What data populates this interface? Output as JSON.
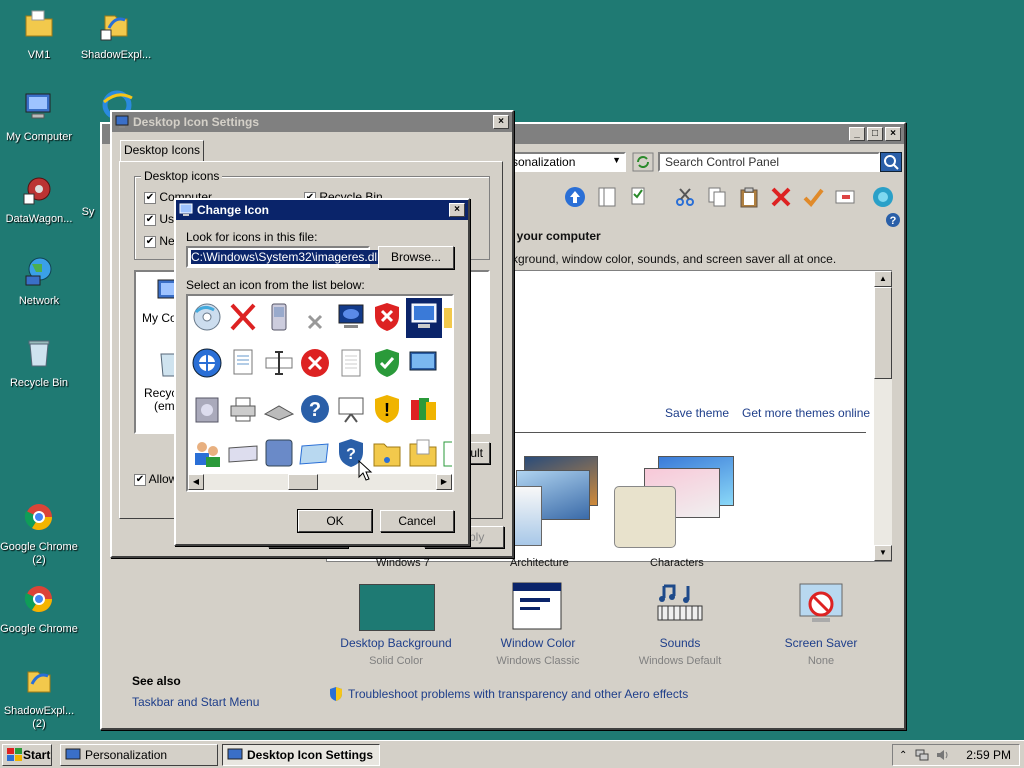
{
  "desktop": {
    "icons": [
      {
        "label": "VM1"
      },
      {
        "label": "ShadowExpl..."
      },
      {
        "label": "My Computer"
      },
      {
        "label": "DataWagon..."
      },
      {
        "label": "Sy"
      },
      {
        "label": "Network"
      },
      {
        "label": "Recycle Bin"
      },
      {
        "label": "Google Chrome\n(2)"
      },
      {
        "label": "Google Chrome"
      },
      {
        "label": "ShadowExpl...\n(2)"
      }
    ]
  },
  "control_panel": {
    "address_text": "sonalization",
    "search_placeholder": "Search Control Panel",
    "heading": "n your computer",
    "description": "ckground, window color, sounds, and screen saver all at once.",
    "save_theme": "Save theme",
    "get_more_themes": "Get more themes online",
    "themes": [
      {
        "label": "Windows 7"
      },
      {
        "label": "Architecture"
      },
      {
        "label": "Characters"
      }
    ],
    "bottom_items": [
      {
        "title": "Desktop Background",
        "subtitle": "Solid Color"
      },
      {
        "title": "Window Color",
        "subtitle": "Windows Classic"
      },
      {
        "title": "Sounds",
        "subtitle": "Windows Default"
      },
      {
        "title": "Screen Saver",
        "subtitle": "None"
      }
    ],
    "see_also_label": "See also",
    "taskbar_link": "Taskbar and Start Menu",
    "troubleshoot_link": "Troubleshoot problems with transparency and other Aero effects",
    "accent_color": "#1e7a73"
  },
  "desktop_icon_settings": {
    "title": "Desktop Icon Settings",
    "tab_label": "Desktop Icons",
    "group_label": "Desktop icons",
    "checkboxes": [
      {
        "label": "Computer",
        "checked": true
      },
      {
        "label": "Us",
        "checked": true
      },
      {
        "label": "Ne",
        "checked": true
      },
      {
        "label": "Recycle Bin",
        "checked": true
      }
    ],
    "preview_labels": [
      "My Co",
      "Recyc",
      "(emp"
    ],
    "allow_label": "Allow",
    "restore_default_fragment": "ault",
    "apply_fragment": "ply"
  },
  "change_icon": {
    "title": "Change Icon",
    "look_label": "Look for icons in this file:",
    "file_path": "C:\\Windows\\System32\\imageres.dll",
    "browse_label": "Browse...",
    "select_label": "Select an icon from the list below:",
    "ok_label": "OK",
    "cancel_label": "Cancel"
  },
  "taskbar": {
    "start_label": "Start",
    "tasks": [
      {
        "label": "Personalization"
      },
      {
        "label": "Desktop Icon Settings"
      }
    ],
    "clock": "2:59 PM"
  }
}
